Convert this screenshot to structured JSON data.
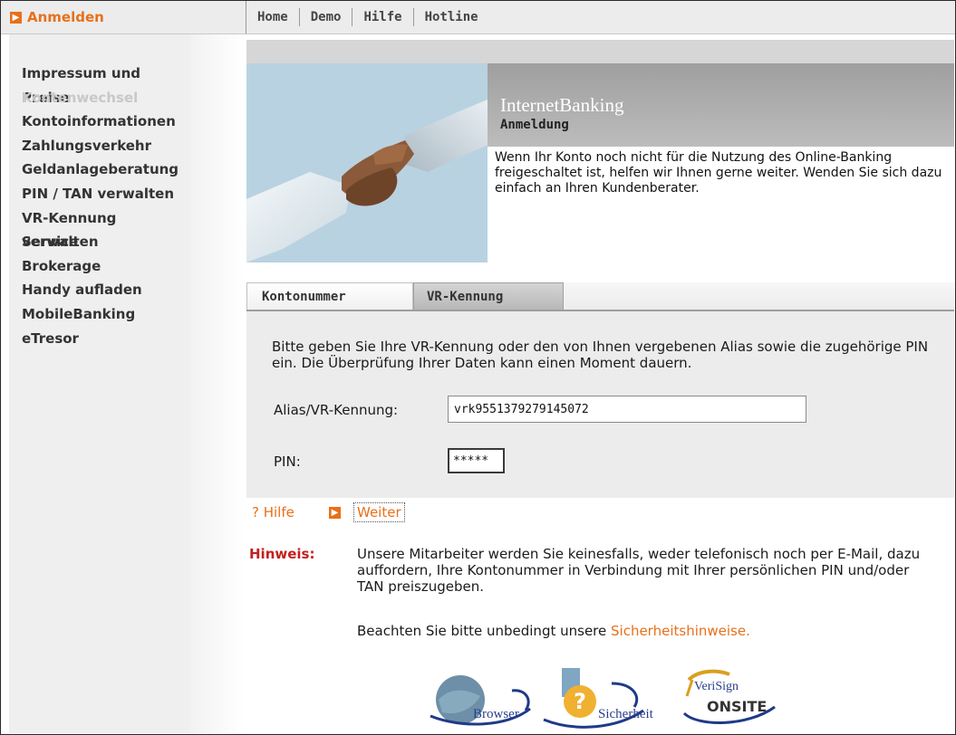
{
  "topbar": {
    "login_label": "Anmelden",
    "nav": [
      "Home",
      "Demo",
      "Hilfe",
      "Hotline"
    ]
  },
  "sidebar": {
    "items": [
      {
        "label": "Impressum und Preise",
        "disabled": false
      },
      {
        "label": "Kontenwechsel",
        "disabled": true
      },
      {
        "label": "Kontoinformationen",
        "disabled": false
      },
      {
        "label": "Zahlungsverkehr",
        "disabled": false
      },
      {
        "label": "Geldanlageberatung",
        "disabled": false
      },
      {
        "label": "PIN / TAN verwalten",
        "disabled": false
      },
      {
        "label": "VR-Kennung verwalten",
        "disabled": false
      },
      {
        "label": "Service",
        "disabled": false
      },
      {
        "label": "Brokerage",
        "disabled": false
      },
      {
        "label": "Handy aufladen",
        "disabled": false
      },
      {
        "label": "MobileBanking",
        "disabled": false
      },
      {
        "label": "eTresor",
        "disabled": false
      }
    ]
  },
  "header": {
    "title": "InternetBanking",
    "subtitle": "Anmeldung",
    "intro": "Wenn Ihr Konto noch nicht für die Nutzung des Online-Banking freigeschaltet ist, helfen wir Ihnen gerne weiter. Wenden Sie sich dazu einfach an Ihren Kundenberater."
  },
  "tabs": [
    {
      "label": "Kontonummer",
      "active": false
    },
    {
      "label": "VR-Kennung",
      "active": true
    }
  ],
  "form": {
    "instructions": "Bitte geben Sie Ihre VR-Kennung oder den von Ihnen vergebenen Alias sowie die zugehörige PIN ein. Die Überprüfung Ihrer Daten kann einen Moment dauern.",
    "alias_label": "Alias/VR-Kennung:",
    "alias_value": "vrk9551379279145072",
    "pin_label": "PIN:",
    "pin_value": "*****"
  },
  "actions": {
    "help": "? Hilfe",
    "next": "Weiter"
  },
  "notice": {
    "title": "Hinweis:",
    "text": "Unsere Mitarbeiter werden Sie keinesfalls, weder telefonisch noch per E-Mail, dazu auffordern, Ihre Kontonummer in Verbindung mit Ihrer persönlichen PIN und/oder TAN preiszugeben.",
    "security_prefix": "Beachten Sie bitte unbedingt unsere ",
    "security_link": "Sicherheitshinweise."
  },
  "badges": {
    "browser": "Browser",
    "security": "Sicherheit",
    "verisign_top": "VeriSign",
    "verisign_bottom": "ONSITE"
  },
  "colors": {
    "accent": "#e8701a",
    "warning": "#c22020",
    "sidebar_bg": "#efefef"
  }
}
